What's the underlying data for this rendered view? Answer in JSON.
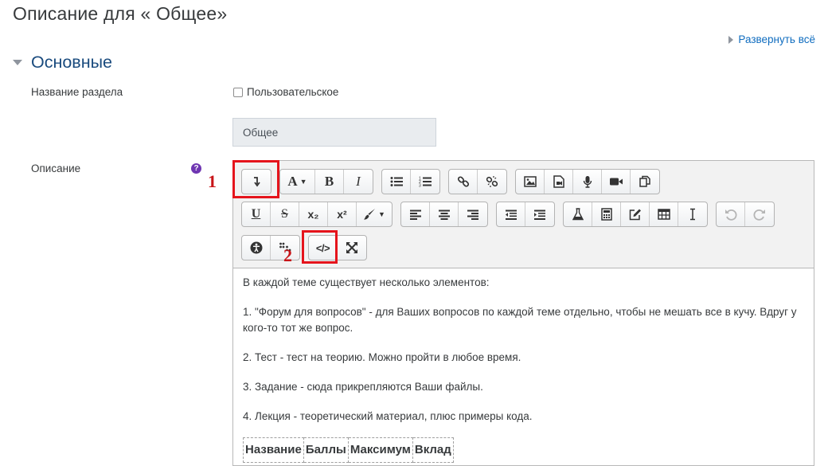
{
  "page": {
    "title": "Описание для « Общее»"
  },
  "expand_all": {
    "label": "Развернуть всё"
  },
  "section": {
    "title": "Основные"
  },
  "fields": {
    "section_name_label": "Название раздела",
    "custom_checkbox_label": "Пользовательское",
    "section_name_value": "Общее",
    "description_label": "Описание",
    "help_icon_glyph": "?"
  },
  "toolbar": {
    "bold_glyph": "B",
    "italic_glyph": "I",
    "font_glyph": "A",
    "underline_glyph": "U",
    "strike_glyph": "S",
    "subscript_glyph": "x₂",
    "superscript_glyph": "x²",
    "html_glyph": "</>"
  },
  "content": {
    "paragraphs": [
      "В каждой теме существует несколько элементов:",
      "1. \"Форум для вопросов\" - для Ваших вопросов по каждой теме отдельно, чтобы не мешать все в кучу. Вдруг у кого-то тот же вопрос.",
      "2. Тест - тест на теорию. Можно пройти в любое время.",
      "3. Задание - сюда прикрепляются Ваши файлы.",
      "4. Лекция - теоретический материал, плюс примеры кода."
    ],
    "table_headers": [
      "Название",
      "Баллы",
      "Максимум",
      "Вклад"
    ]
  },
  "annotations": {
    "marker_1": "1",
    "marker_2": "2",
    "color": "#e5141c"
  }
}
